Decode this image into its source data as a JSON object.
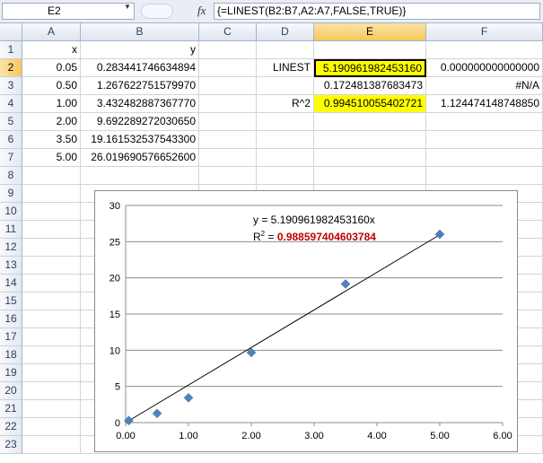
{
  "formula_bar": {
    "name_box": "E2",
    "fx_icon": "fx-icon",
    "formula": "{=LINEST(B2:B7,A2:A7,FALSE,TRUE)}"
  },
  "columns": [
    "A",
    "B",
    "C",
    "D",
    "E",
    "F"
  ],
  "rows": [
    "1",
    "2",
    "3",
    "4",
    "5",
    "6",
    "7",
    "8",
    "9",
    "10",
    "11",
    "12",
    "13",
    "14",
    "15",
    "16",
    "17",
    "18",
    "19",
    "20",
    "21",
    "22",
    "23"
  ],
  "cells": {
    "A1": "x",
    "B1": "y",
    "A2": "0.05",
    "B2": "0.283441746634894",
    "A3": "0.50",
    "B3": "1.267622751579970",
    "A4": "1.00",
    "B4": "3.432482887367770",
    "A5": "2.00",
    "B5": "9.692289272030650",
    "A6": "3.50",
    "B6": "19.161532537543300",
    "A7": "5.00",
    "B7": "26.019690576652600",
    "D2": "LINEST",
    "E2": "5.190961982453160",
    "F2": "0.000000000000000",
    "E3": "0.172481387683473",
    "F3": "#N/A",
    "D4": "R^2",
    "E4": "0.994510055402721",
    "F4": "1.124474148748850"
  },
  "colors": {
    "highlight": "#ffff00",
    "marker": "#4f81bd",
    "r2": "#c00000"
  },
  "chart_data": {
    "type": "scatter",
    "x": [
      0.05,
      0.5,
      1.0,
      2.0,
      3.5,
      5.0
    ],
    "y": [
      0.283441746634894,
      1.26762275157997,
      3.43248288736777,
      9.69228927203065,
      19.1615325375433,
      26.0196905766526
    ],
    "trendline": {
      "slope": 5.19096198245316,
      "intercept": 0,
      "x_range": [
        0,
        5
      ]
    },
    "equation": "y = 5.190961982453160x",
    "r2_prefix": "R",
    "r2_sup": "2",
    "r2_eq": " = ",
    "r2_value": "0.988597404603784",
    "xlim": [
      0,
      6
    ],
    "ylim": [
      0,
      30
    ],
    "xticks": [
      "0.00",
      "1.00",
      "2.00",
      "3.00",
      "4.00",
      "5.00",
      "6.00"
    ],
    "yticks": [
      "0",
      "5",
      "10",
      "15",
      "20",
      "25",
      "30"
    ],
    "grid": "horizontal",
    "marker": "diamond"
  }
}
